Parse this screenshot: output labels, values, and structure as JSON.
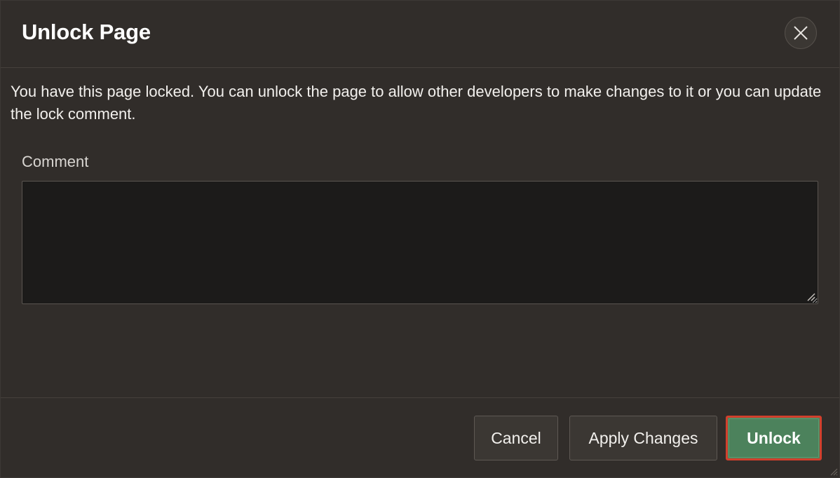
{
  "dialog": {
    "title": "Unlock Page",
    "close_icon": "close-icon"
  },
  "body": {
    "message": "You have this page locked. You can unlock the page to allow other developers to make changes to it or you can update the lock comment.",
    "comment": {
      "label": "Comment",
      "value": ""
    }
  },
  "footer": {
    "cancel_label": "Cancel",
    "apply_label": "Apply Changes",
    "unlock_label": "Unlock"
  },
  "colors": {
    "background": "#312d2a",
    "input_background": "#1c1b1a",
    "primary_button": "#4c825c",
    "highlight_border": "#d2402d",
    "text": "#f2f0ed"
  }
}
